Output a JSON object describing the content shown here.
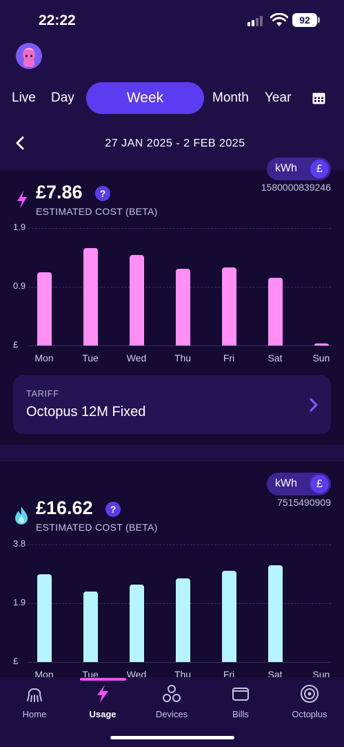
{
  "status_bar": {
    "time": "22:22",
    "battery": "92"
  },
  "period_tabs": [
    {
      "label": "Live",
      "active": false
    },
    {
      "label": "Day",
      "active": false
    },
    {
      "label": "Week",
      "active": true
    },
    {
      "label": "Month",
      "active": false
    },
    {
      "label": "Year",
      "active": false
    }
  ],
  "date_range": "27 JAN 2025 - 2 FEB 2025",
  "electricity": {
    "unit_toggle": {
      "kwh": "kWh",
      "gbp": "£"
    },
    "meter_id": "1580000839246",
    "cost": "£7.86",
    "help": "?",
    "cost_label": "ESTIMATED COST (BETA)",
    "tariff": {
      "label": "TARIFF",
      "name": "Octopus 12M Fixed"
    },
    "chart_data": {
      "type": "bar",
      "categories": [
        "Mon",
        "Tue",
        "Wed",
        "Thu",
        "Fri",
        "Sat",
        "Sun"
      ],
      "values": [
        1.18,
        1.58,
        1.46,
        1.24,
        1.26,
        1.1,
        0.03
      ],
      "y_tick_labels": [
        "1.9",
        "0.9",
        "£"
      ],
      "ylim": [
        0,
        1.9
      ],
      "color": "#ff8ef5"
    }
  },
  "gas": {
    "unit_toggle": {
      "kwh": "kWh",
      "gbp": "£"
    },
    "meter_id": "7515490909",
    "cost": "£16.62",
    "help": "?",
    "cost_label": "ESTIMATED COST (BETA)",
    "chart_data": {
      "type": "bar",
      "categories": [
        "Mon",
        "Tue",
        "Wed",
        "Thu",
        "Fri",
        "Sat",
        "Sun"
      ],
      "values": [
        2.84,
        2.28,
        2.5,
        2.7,
        2.96,
        3.14,
        0
      ],
      "y_tick_labels": [
        "3.8",
        "1.9",
        "£"
      ],
      "ylim": [
        0,
        3.8
      ],
      "color": "#b6f4ff"
    }
  },
  "bottom_nav": [
    {
      "label": "Home",
      "icon": "octopus-icon",
      "active": false
    },
    {
      "label": "Usage",
      "icon": "lightning-icon",
      "active": true
    },
    {
      "label": "Devices",
      "icon": "devices-icon",
      "active": false
    },
    {
      "label": "Bills",
      "icon": "wallet-icon",
      "active": false
    },
    {
      "label": "Octoplus",
      "icon": "octoplus-icon",
      "active": false
    }
  ],
  "colors": {
    "accent": "#5b3cf0",
    "background": "#180d3a",
    "electric": "#ff8ef5",
    "gas": "#b6f4ff",
    "nav_highlight": "#f050f8"
  }
}
